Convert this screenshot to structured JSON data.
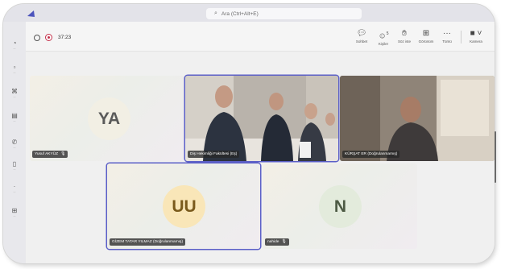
{
  "search": {
    "placeholder": "Ara (Ctrl+Alt+E)",
    "icon": "search-icon"
  },
  "sidebar": {
    "items": [
      {
        "icon": "activity-icon",
        "label": "..."
      },
      {
        "icon": "chat-icon",
        "label": "..."
      },
      {
        "icon": "teams-icon",
        "label": "..."
      },
      {
        "icon": "calendar-icon",
        "label": "..."
      },
      {
        "icon": "calls-icon",
        "label": "..."
      },
      {
        "icon": "files-icon",
        "label": "..."
      },
      {
        "icon": "more-icon",
        "label": "..."
      },
      {
        "icon": "apps-icon",
        "label": "..."
      }
    ]
  },
  "meeting": {
    "timer": "37:23",
    "toolbar": [
      {
        "name": "chat",
        "icon": "chat-icon",
        "label": "Sohbet",
        "badge": ""
      },
      {
        "name": "people",
        "icon": "people-icon",
        "label": "Kişiler",
        "badge": "5"
      },
      {
        "name": "raise-hand",
        "icon": "hand-icon",
        "label": "Söz iste",
        "badge": ""
      },
      {
        "name": "view",
        "icon": "grid-icon",
        "label": "Görünüm",
        "badge": ""
      },
      {
        "name": "more",
        "icon": "more-icon",
        "label": "Tümü",
        "badge": ""
      },
      {
        "name": "camera",
        "icon": "camera-icon",
        "label": "Kamera",
        "badge": ""
      }
    ]
  },
  "participants": [
    {
      "initials": "YA",
      "name": "Yusuf AKYÜZ",
      "muted": true,
      "video": false,
      "avatar_bg": "#f2efe4",
      "avatar_fg": "#5a5a5a"
    },
    {
      "initials": "",
      "name": "Diş Hekimliği Fakültesi (Eş)",
      "muted": false,
      "video": true,
      "active": true
    },
    {
      "initials": "",
      "name": "KÜRŞAT ER (Doğrulanmamış)",
      "muted": false,
      "video": true
    },
    {
      "initials": "UU",
      "name": "GİZEM TATAR YILMAZ (Doğrulanmamış)",
      "muted": false,
      "video": false,
      "active": true,
      "avatar_bg": "#f9e6b8",
      "avatar_fg": "#7a5a1c"
    },
    {
      "initials": "N",
      "name": "nahide",
      "muted": true,
      "video": false,
      "avatar_bg": "#e3ebdc",
      "avatar_fg": "#4d5a44"
    }
  ],
  "colors": {
    "accent": "#5b5fc7",
    "recording": "#c4314b"
  }
}
